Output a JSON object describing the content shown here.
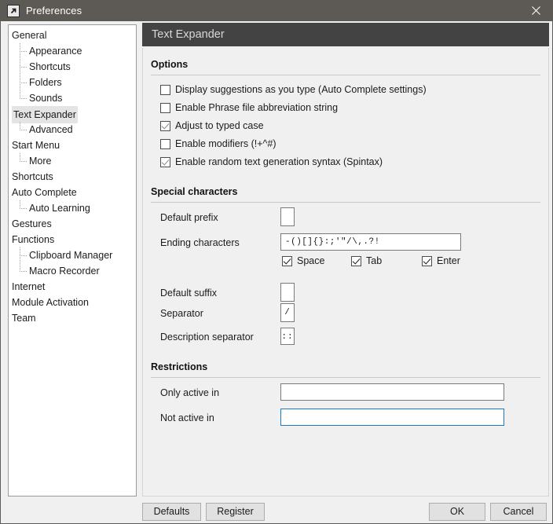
{
  "window": {
    "title": "Preferences",
    "icon": "arrow-up-right-icon",
    "close_label": "close-icon"
  },
  "sidebar": {
    "items": [
      {
        "label": "General",
        "level": 0,
        "selected": false,
        "last": false
      },
      {
        "label": "Appearance",
        "level": 1,
        "selected": false,
        "last": false
      },
      {
        "label": "Shortcuts",
        "level": 1,
        "selected": false,
        "last": false
      },
      {
        "label": "Folders",
        "level": 1,
        "selected": false,
        "last": false
      },
      {
        "label": "Sounds",
        "level": 1,
        "selected": false,
        "last": true
      },
      {
        "label": "Text Expander",
        "level": 0,
        "selected": true,
        "last": false
      },
      {
        "label": "Advanced",
        "level": 1,
        "selected": false,
        "last": true
      },
      {
        "label": "Start Menu",
        "level": 0,
        "selected": false,
        "last": false
      },
      {
        "label": "More",
        "level": 1,
        "selected": false,
        "last": true
      },
      {
        "label": "Shortcuts",
        "level": 0,
        "selected": false,
        "last": false
      },
      {
        "label": "Auto Complete",
        "level": 0,
        "selected": false,
        "last": false
      },
      {
        "label": "Auto Learning",
        "level": 1,
        "selected": false,
        "last": true
      },
      {
        "label": "Gestures",
        "level": 0,
        "selected": false,
        "last": false
      },
      {
        "label": "Functions",
        "level": 0,
        "selected": false,
        "last": false
      },
      {
        "label": "Clipboard Manager",
        "level": 1,
        "selected": false,
        "last": false
      },
      {
        "label": "Macro Recorder",
        "level": 1,
        "selected": false,
        "last": true
      },
      {
        "label": "Internet",
        "level": 0,
        "selected": false,
        "last": false
      },
      {
        "label": "Module Activation",
        "level": 0,
        "selected": false,
        "last": false
      },
      {
        "label": "Team",
        "level": 0,
        "selected": false,
        "last": false
      }
    ]
  },
  "content": {
    "header": "Text Expander",
    "options": {
      "title": "Options",
      "checkboxes": [
        {
          "label": "Display suggestions as you type (Auto Complete settings)",
          "checked": false
        },
        {
          "label": "Enable Phrase file abbreviation string",
          "checked": false
        },
        {
          "label": "Adjust to typed case",
          "checked": true
        },
        {
          "label": "Enable modifiers (!+^#)",
          "checked": false
        },
        {
          "label": "Enable random text generation syntax (Spintax)",
          "checked": true
        }
      ]
    },
    "special_characters": {
      "title": "Special characters",
      "default_prefix": {
        "label": "Default prefix",
        "value": ""
      },
      "ending_characters": {
        "label": "Ending characters",
        "value": "-()[]{}:;'\"/\\,.?!"
      },
      "ending_toggles": [
        {
          "label": "Space",
          "checked": true
        },
        {
          "label": "Tab",
          "checked": true
        },
        {
          "label": "Enter",
          "checked": true
        }
      ],
      "default_suffix": {
        "label": "Default suffix",
        "value": ""
      },
      "separator": {
        "label": "Separator",
        "value": "/"
      },
      "description_separator": {
        "label": "Description separator",
        "value": "::"
      }
    },
    "restrictions": {
      "title": "Restrictions",
      "only_active_in": {
        "label": "Only active in",
        "value": "",
        "focused": false
      },
      "not_active_in": {
        "label": "Not active in",
        "value": "",
        "focused": true
      }
    }
  },
  "footer": {
    "defaults_label": "Defaults",
    "register_label": "Register",
    "ok_label": "OK",
    "cancel_label": "Cancel"
  },
  "colors": {
    "titlebar": "#5d5a55",
    "header_bar": "#434343",
    "focus_border": "#1a7bc4",
    "selection": "#e4e4e4"
  }
}
